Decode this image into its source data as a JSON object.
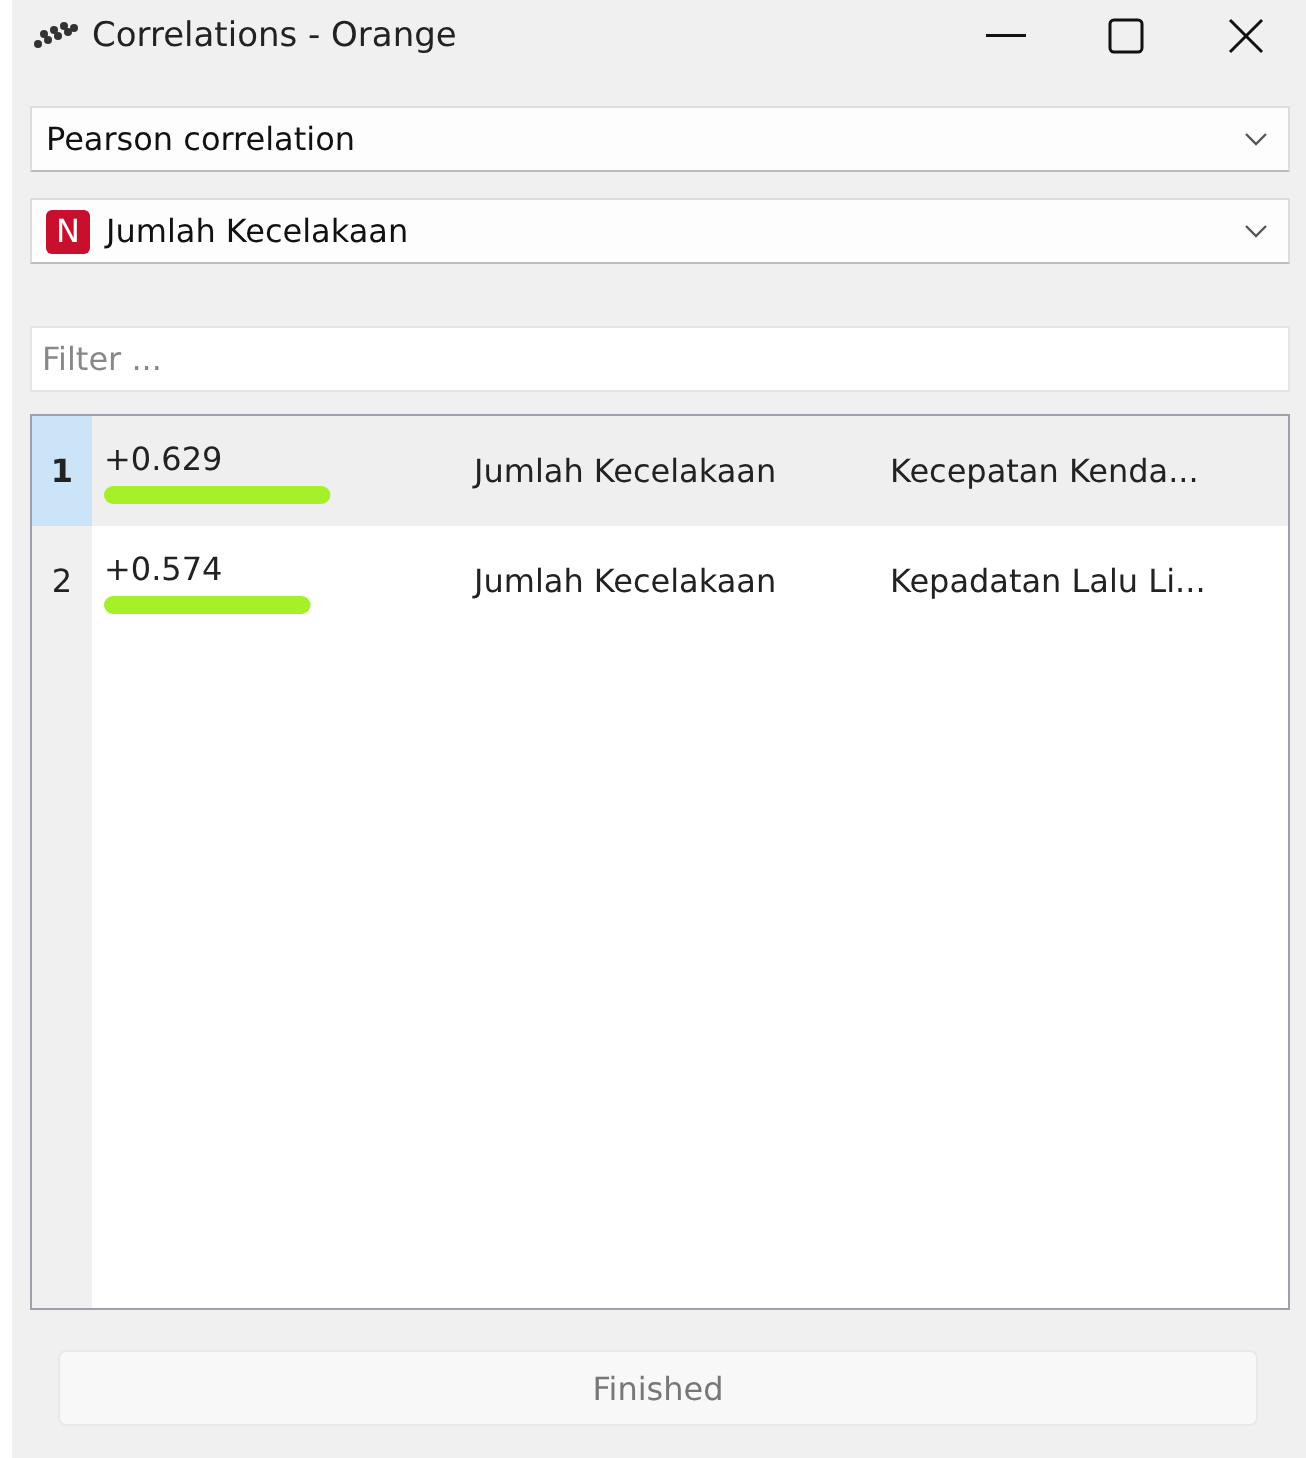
{
  "window": {
    "title": "Correlations - Orange"
  },
  "correlation_type": {
    "value": "Pearson correlation"
  },
  "feature": {
    "badge": "N",
    "value": "Jumlah Kecelakaan"
  },
  "filter": {
    "placeholder": "Filter ..."
  },
  "rows": [
    {
      "index": "1",
      "selected": true,
      "value": "+0.629",
      "level": 0.629,
      "feature_1": "Jumlah Kecelakaan",
      "feature_2": "Kecepatan Kenda..."
    },
    {
      "index": "2",
      "selected": false,
      "value": "+0.574",
      "level": 0.574,
      "feature_1": "Jumlah Kecelakaan",
      "feature_2": "Kepadatan Lalu Li..."
    }
  ],
  "status_button": {
    "label": "Finished",
    "disabled": true
  }
}
